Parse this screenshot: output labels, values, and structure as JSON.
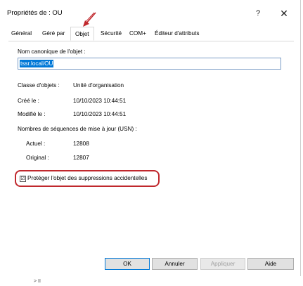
{
  "window": {
    "title": "Propriétés de : OU",
    "help_label": "?",
    "close_label": "✕"
  },
  "tabs": [
    {
      "label": "Général"
    },
    {
      "label": "Géré par"
    },
    {
      "label": "Objet"
    },
    {
      "label": "Sécurité"
    },
    {
      "label": "COM+"
    },
    {
      "label": "Éditeur d'attributs"
    }
  ],
  "object": {
    "canonical_label": "Nom canonique de l'objet :",
    "canonical_value": "tssr.local/OU",
    "class_label": "Classe d'objets :",
    "class_value": "Unité d'organisation",
    "created_label": "Créé le :",
    "created_value": "10/10/2023 10:44:51",
    "modified_label": "Modifié le :",
    "modified_value": "10/10/2023 10:44:51",
    "usn_label": "Nombres de séquences de mise à jour (USN) :",
    "current_label": "Actuel :",
    "current_value": "12808",
    "original_label": "Original :",
    "original_value": "12807",
    "protect_label": "Protéger l'objet des suppressions accidentelles",
    "protect_checked": "☑"
  },
  "buttons": {
    "ok": "OK",
    "cancel": "Annuler",
    "apply": "Appliquer",
    "help": "Aide"
  },
  "below": {
    "text": "> II"
  },
  "colors": {
    "annotation_red": "#c0282d",
    "selection_blue": "#0078d7"
  }
}
